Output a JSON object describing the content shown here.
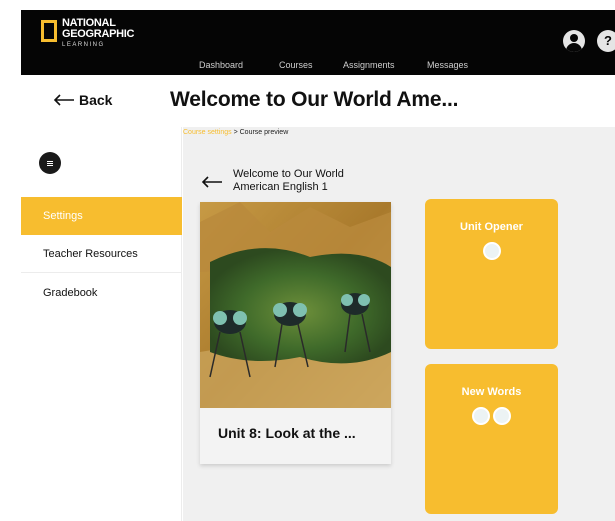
{
  "brand": {
    "line1": "NATIONAL",
    "line2": "GEOGRAPHIC",
    "line3": "LEARNING",
    "accent_color": "#f7bd2f"
  },
  "nav": {
    "items": [
      "Dashboard",
      "Courses",
      "Assignments",
      "Messages"
    ]
  },
  "header": {
    "back_label": "Back",
    "title": "Welcome to Our World Ame..."
  },
  "help": {
    "label": "?"
  },
  "sidebar": {
    "items": [
      {
        "label": "Settings",
        "active": true
      },
      {
        "label": "Teacher Resources",
        "active": false
      },
      {
        "label": "Gradebook",
        "active": false
      }
    ]
  },
  "breadcrumb": {
    "link": "Course settings",
    "separator": " > ",
    "current": "Course preview"
  },
  "course": {
    "name_line1": "Welcome to Our World",
    "name_line2": "American English 1"
  },
  "unit": {
    "title": "Unit 8: Look at the ..."
  },
  "lessons": [
    {
      "title": "Unit Opener",
      "circles": 1
    },
    {
      "title": "New Words",
      "circles": 2
    }
  ],
  "icons": {
    "back": "arrow-left-icon",
    "course_back": "arrow-left-icon",
    "menu": "hamburger-menu-icon",
    "profile": "user-avatar-icon",
    "help": "help-icon"
  }
}
